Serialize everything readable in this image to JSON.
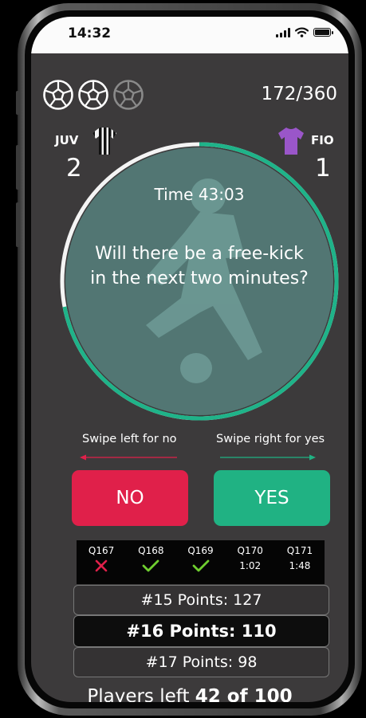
{
  "status": {
    "time": "14:32",
    "icons": [
      "signal-icon",
      "wifi-icon",
      "battery-icon"
    ]
  },
  "lives": {
    "total": 3,
    "remaining": 2,
    "icon": "soccer-ball-icon"
  },
  "progress": "172/360",
  "teams": {
    "home": {
      "name": "JUV",
      "score": "2",
      "shirt": "striped-shirt-icon"
    },
    "away": {
      "name": "FIO",
      "score": "1",
      "shirt": "purple-shirt-icon"
    }
  },
  "question": {
    "time": "Time 43:03",
    "text": "Will there be a free-kick in the next two minutes?",
    "timer_remaining_fraction": 0.72
  },
  "hints": {
    "no": "Swipe left for no",
    "yes": "Swipe right for yes"
  },
  "buttons": {
    "no": "NO",
    "yes": "YES"
  },
  "history": [
    {
      "id": "Q167",
      "result": "wrong"
    },
    {
      "id": "Q168",
      "result": "correct"
    },
    {
      "id": "Q169",
      "result": "correct"
    },
    {
      "id": "Q170",
      "result": "1:02"
    },
    {
      "id": "Q171",
      "result": "1:48"
    }
  ],
  "leaderboard": [
    {
      "text": "#15 Points: 127",
      "current": false
    },
    {
      "text": "#16 Points: 110",
      "current": true
    },
    {
      "text": "#17 Points: 98",
      "current": false
    }
  ],
  "players": {
    "prefix": "Players left",
    "count": "42 of 100"
  },
  "colors": {
    "accent": "#1fb389",
    "no": "#e0204a",
    "yes": "#20b283",
    "background": "#3c3a3b"
  }
}
